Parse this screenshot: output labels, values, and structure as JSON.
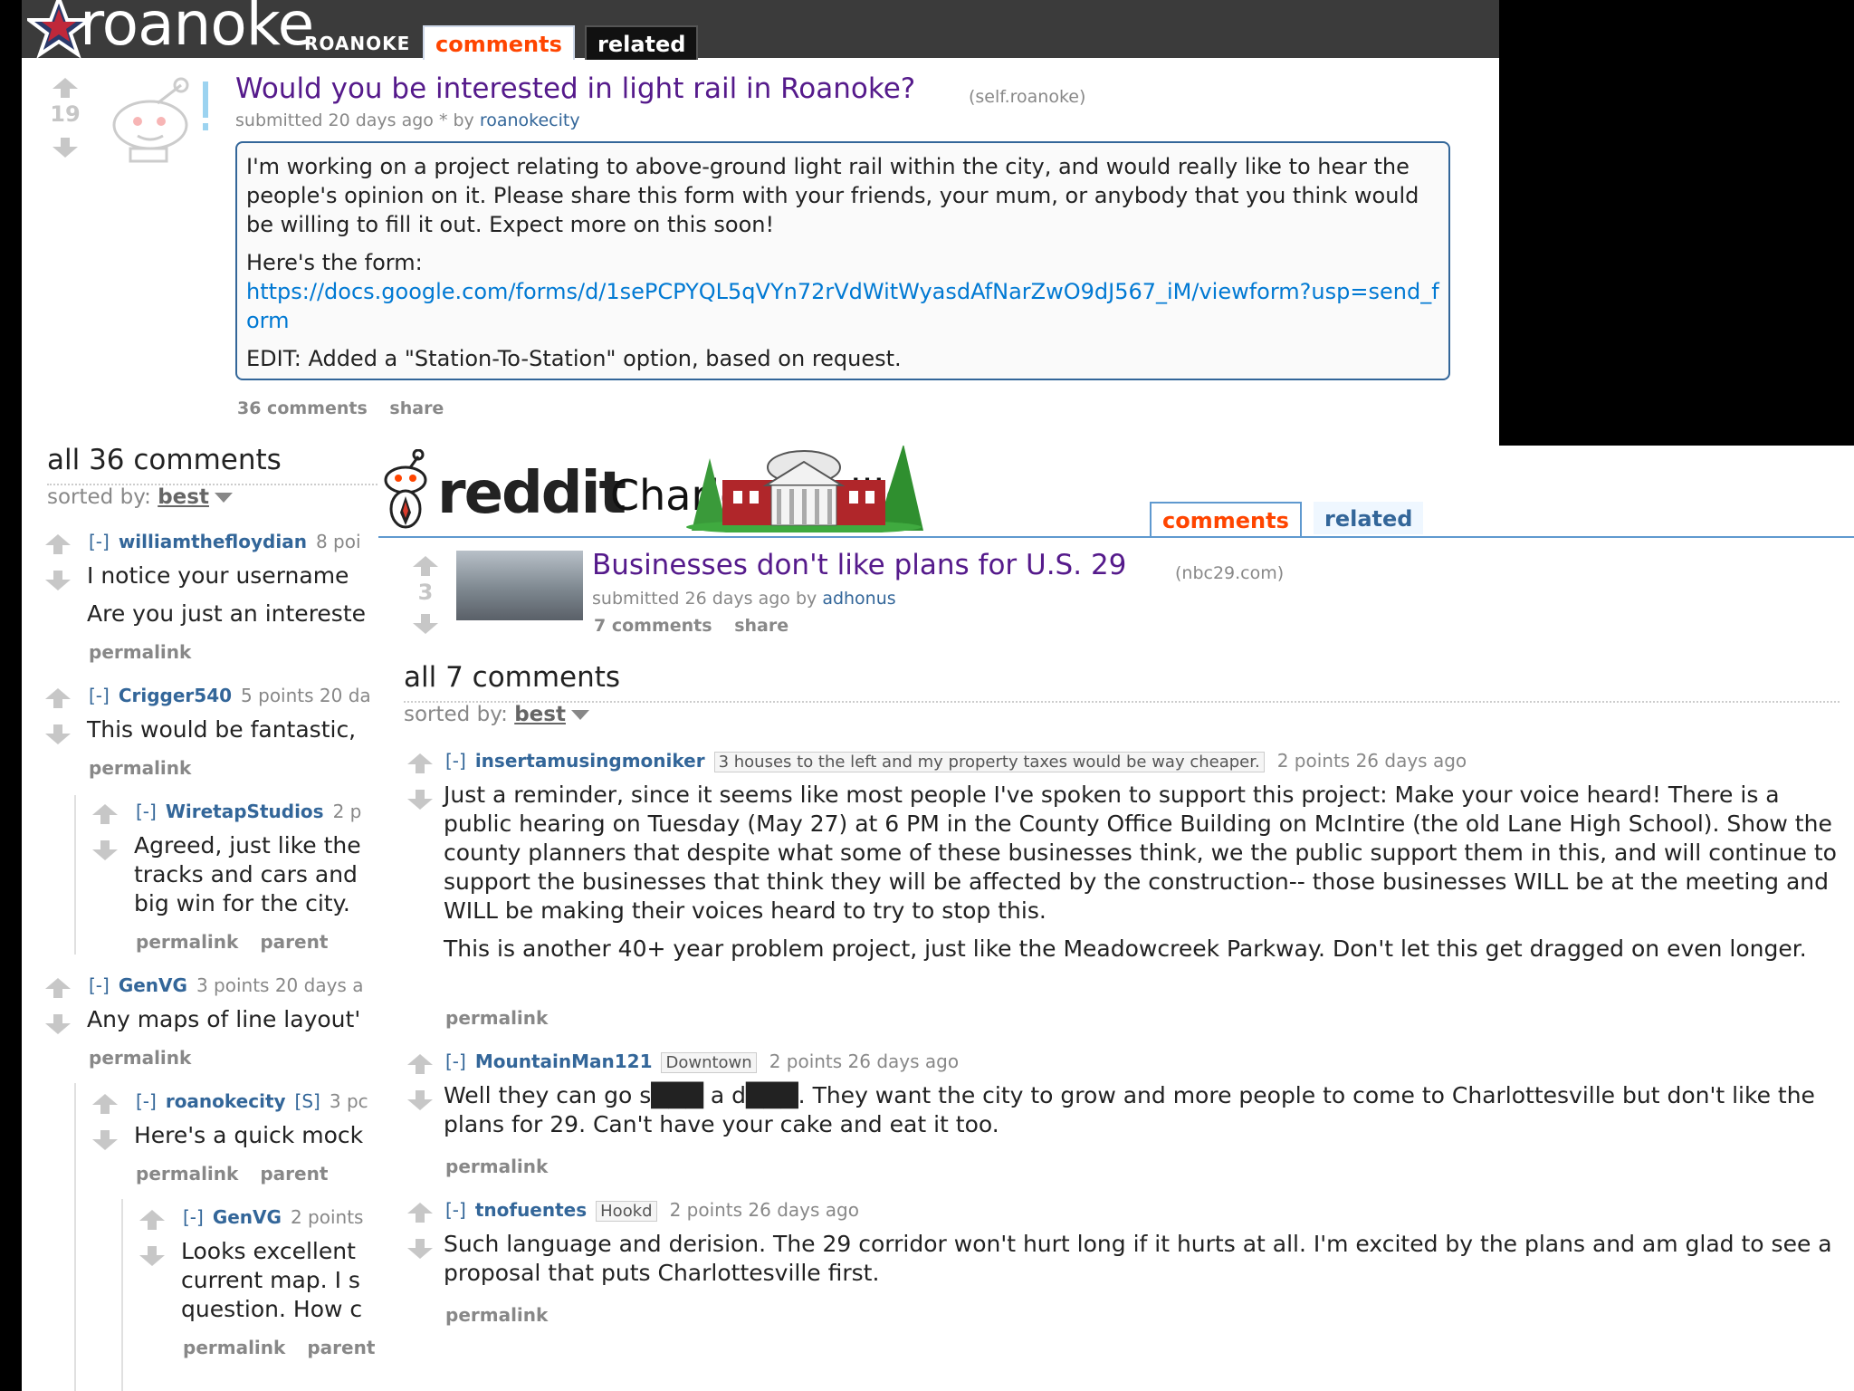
{
  "roanoke": {
    "header": {
      "logo_text": "roanoke",
      "subreddit_name": "ROANOKE",
      "tab_comments": "comments",
      "tab_related": "related"
    },
    "post": {
      "score": "19",
      "title": "Would you be interested in light rail in Roanoke?",
      "domain": "(self.roanoke)",
      "tagline_prefix": "submitted 20 days ago * by",
      "author": "roanokecity",
      "selftext": {
        "p1": "I'm working on a project relating to above-ground light rail within the city, and would really like to hear the people's opinion on it. Please share this form with your friends, your mum, or anybody that you think would be willing to fill it out. Expect more on this soon!",
        "p2_label": "Here's the form:",
        "link": "https://docs.google.com/forms/d/1sePCPYQL5qVYn72rVdWitWyasdAfNarZwO9dJ567_iM/viewform?usp=send_form",
        "p3": "EDIT: Added a \"Station-To-Station\" option, based on request."
      },
      "comments_count": "36 comments",
      "share": "share"
    },
    "all_comments": "all 36 comments",
    "sorted_label": "sorted by:",
    "sorted_value": "best",
    "comments": [
      {
        "toggle": "[-]",
        "user": "williamthefloydian",
        "meta": "8 poi",
        "body1": "I notice your username",
        "body2": "Are you just an intereste",
        "btns": [
          "permalink"
        ]
      },
      {
        "toggle": "[-]",
        "user": "Crigger540",
        "meta": "5 points 20 da",
        "body1": "This would be fantastic,",
        "btns": [
          "permalink"
        ]
      },
      {
        "toggle": "[-]",
        "user": "WiretapStudios",
        "meta": "2 p",
        "body1": "Agreed, just like the",
        "body2": "tracks and cars and",
        "body3": "big win for the city.",
        "btns": [
          "permalink",
          "parent"
        ]
      },
      {
        "toggle": "[-]",
        "user": "GenVG",
        "meta": "3 points 20 days a",
        "body1": "Any maps of line layout'",
        "btns": [
          "permalink"
        ]
      },
      {
        "toggle": "[-]",
        "user": "roanokecity",
        "submitter": "[S]",
        "meta": "3 pc",
        "body1": "Here's a quick mock",
        "btns": [
          "permalink",
          "parent"
        ]
      },
      {
        "toggle": "[-]",
        "user": "GenVG",
        "meta": "2 points",
        "body1": "Looks excellent",
        "body2": "current map. I s",
        "body3": "question. How c",
        "btns": [
          "permalink",
          "parent"
        ]
      }
    ]
  },
  "cville": {
    "header": {
      "wordmark": "reddit",
      "subreddit_name": "Charlottesville",
      "tab_comments": "comments",
      "tab_related": "related"
    },
    "post": {
      "score": "3",
      "title": "Businesses don't like plans for U.S. 29",
      "domain": "(nbc29.com)",
      "tagline_prefix": "submitted 26 days ago by",
      "author": "adhonus",
      "comments_count": "7 comments",
      "share": "share"
    },
    "all_comments": "all 7 comments",
    "sorted_label": "sorted by:",
    "sorted_value": "best",
    "comments": [
      {
        "toggle": "[-]",
        "user": "insertamusingmoniker",
        "flair": "3 houses to the left and my property taxes would be way cheaper.",
        "meta": "2 points 26 days ago",
        "p1": "Just a reminder, since it seems like most people I've spoken to support this project: Make your voice heard! There is a public hearing on Tuesday (May 27) at 6 PM in the County Office Building on McIntire (the old Lane High School). Show the county planners that despite what some of these businesses think, we the public support them in this, and will continue to support the businesses that think they will be affected by the construction-- those businesses WILL be at the meeting and WILL be making their voices heard to try to stop this.",
        "p2": "This is another 40+ year problem project, just like the Meadowcreek Parkway. Don't let this get dragged on even longer.",
        "btn": "permalink"
      },
      {
        "toggle": "[-]",
        "user": "MountainMan121",
        "flair": "Downtown",
        "meta": "2 points 26 days ago",
        "p1": "Well they can go s███ a d███. They want the city to grow and more people to come to Charlottesville but don't like the plans for 29. Can't have your cake and eat it too.",
        "btn": "permalink"
      },
      {
        "toggle": "[-]",
        "user": "tnofuentes",
        "flair": "Hookd",
        "meta": "2 points 26 days ago",
        "p1": "Such language and derision. The 29 corridor won't hurt long if it hurts at all. I'm excited by the plans and am glad to see a proposal that puts Charlottesville first.",
        "btn": "permalink"
      }
    ]
  }
}
